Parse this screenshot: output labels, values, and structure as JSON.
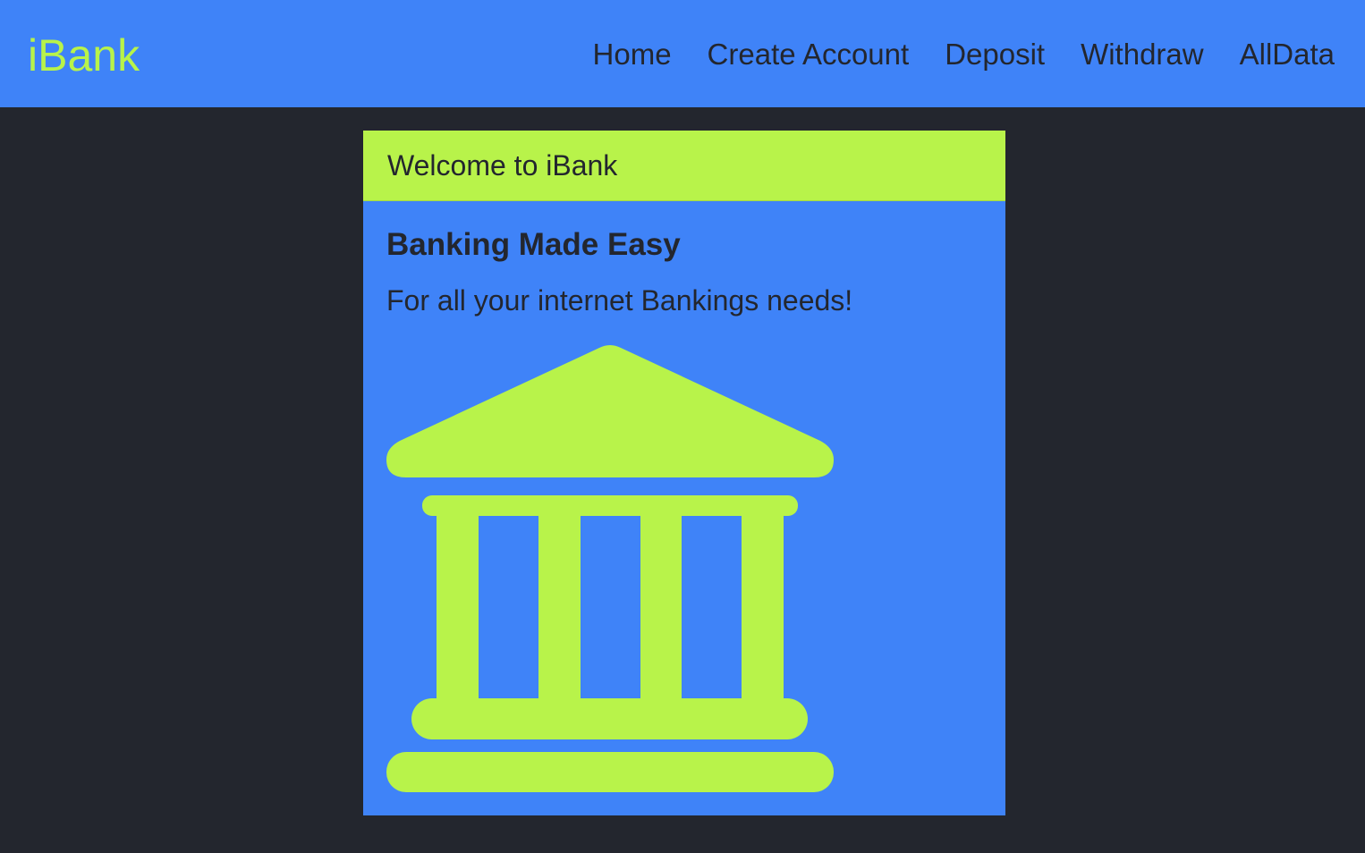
{
  "navbar": {
    "brand": "iBank",
    "links": [
      {
        "label": "Home"
      },
      {
        "label": "Create Account"
      },
      {
        "label": "Deposit"
      },
      {
        "label": "Withdraw"
      },
      {
        "label": "AllData"
      }
    ]
  },
  "card": {
    "header": "Welcome to iBank",
    "title": "Banking Made Easy",
    "text": "For all your internet Bankings needs!",
    "image_icon": "bank-building-icon"
  },
  "colors": {
    "primary": "#3f83f8",
    "accent": "#b8f34a",
    "dark": "#23262e"
  }
}
